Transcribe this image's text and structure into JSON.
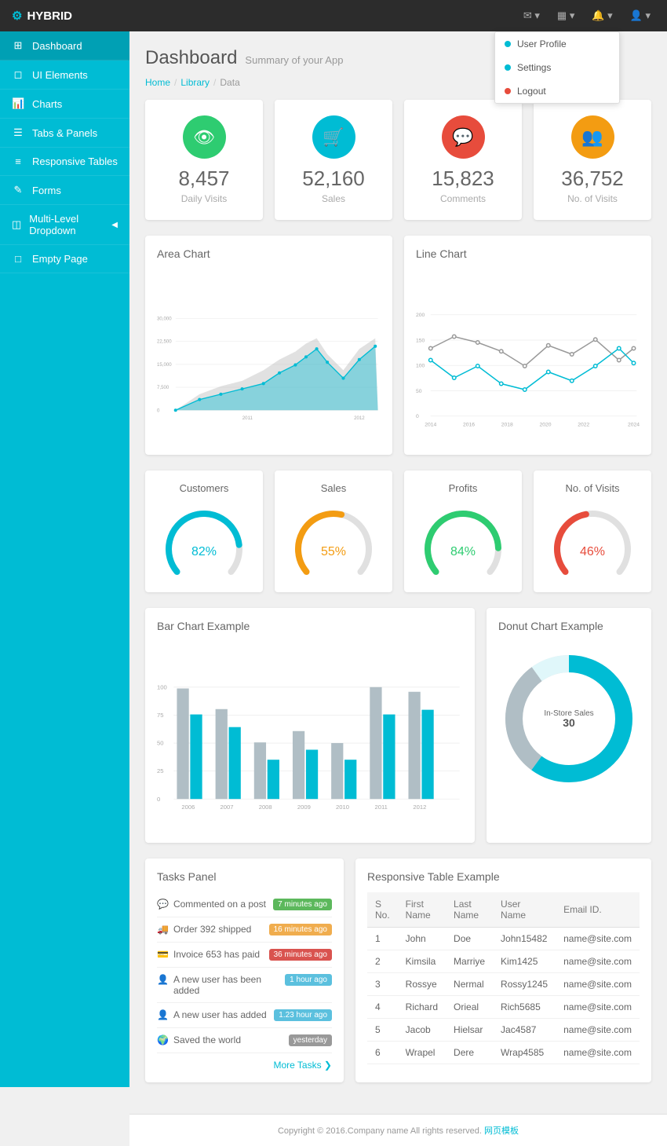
{
  "brand": {
    "name": "HYBRID",
    "icon": "⚙"
  },
  "topnav": {
    "email_icon": "✉",
    "grid_icon": "▦",
    "bell_icon": "🔔",
    "user_icon": "👤"
  },
  "dropdown": {
    "items": [
      {
        "label": "User Profile",
        "dot": "blue"
      },
      {
        "label": "Settings",
        "dot": "teal"
      },
      {
        "label": "Logout",
        "dot": "red"
      }
    ]
  },
  "sidebar": {
    "items": [
      {
        "id": "dashboard",
        "label": "Dashboard",
        "icon": "⊞",
        "active": true
      },
      {
        "id": "ui-elements",
        "label": "UI Elements",
        "icon": "◻"
      },
      {
        "id": "charts",
        "label": "Charts",
        "icon": "📊"
      },
      {
        "id": "tabs-panels",
        "label": "Tabs & Panels",
        "icon": "☰"
      },
      {
        "id": "responsive-tables",
        "label": "Responsive Tables",
        "icon": "≡"
      },
      {
        "id": "forms",
        "label": "Forms",
        "icon": "✎"
      },
      {
        "id": "multi-level",
        "label": "Multi-Level Dropdown",
        "icon": "◫",
        "has_arrow": true
      },
      {
        "id": "empty-page",
        "label": "Empty Page",
        "icon": "□"
      }
    ]
  },
  "page": {
    "title": "Dashboard",
    "subtitle": "Summary of your App"
  },
  "breadcrumb": [
    "Home",
    "Library",
    "Data"
  ],
  "stats": [
    {
      "id": "daily-visits",
      "value": "8,457",
      "label": "Daily Visits",
      "icon": "👁",
      "color": "#2ecc71"
    },
    {
      "id": "sales",
      "value": "52,160",
      "label": "Sales",
      "icon": "🛒",
      "color": "#00bcd4"
    },
    {
      "id": "comments",
      "value": "15,823",
      "label": "Comments",
      "icon": "💬",
      "color": "#e74c3c"
    },
    {
      "id": "no-of-visits",
      "value": "36,752",
      "label": "No. of Visits",
      "icon": "👥",
      "color": "#f39c12"
    }
  ],
  "area_chart": {
    "title": "Area Chart",
    "labels": [
      "2011",
      "2012"
    ],
    "y_labels": [
      "0",
      "7,500",
      "15,000",
      "22,500",
      "30,000"
    ]
  },
  "line_chart": {
    "title": "Line Chart",
    "x_labels": [
      "2014",
      "2016",
      "2018",
      "2020",
      "2022",
      "2024"
    ],
    "y_labels": [
      "0",
      "50",
      "100",
      "150",
      "200"
    ]
  },
  "gauges": [
    {
      "id": "customers",
      "label": "Customers",
      "value": 82,
      "display": "82%",
      "color": "#00bcd4"
    },
    {
      "id": "sales",
      "label": "Sales",
      "value": 55,
      "display": "55%",
      "color": "#f39c12"
    },
    {
      "id": "profits",
      "label": "Profits",
      "value": 84,
      "display": "84%",
      "color": "#2ecc71"
    },
    {
      "id": "no-of-visits",
      "label": "No. of Visits",
      "value": 46,
      "display": "46%",
      "color": "#e74c3c"
    }
  ],
  "bar_chart": {
    "title": "Bar Chart Example",
    "years": [
      "2006",
      "2007",
      "2008",
      "2009",
      "2010",
      "2011",
      "2012"
    ],
    "y_labels": [
      "0",
      "25",
      "50",
      "75",
      "100"
    ],
    "bars": [
      [
        95,
        70
      ],
      [
        80,
        62
      ],
      [
        48,
        35
      ],
      [
        60,
        42
      ],
      [
        47,
        32
      ],
      [
        98,
        75
      ],
      [
        90,
        68
      ]
    ]
  },
  "donut_chart": {
    "title": "Donut Chart Example",
    "center_label": "In-Store Sales",
    "center_value": "30"
  },
  "tasks": {
    "title": "Tasks Panel",
    "items": [
      {
        "text": "Commented on a post",
        "badge": "7 minutes ago",
        "badge_type": "green",
        "icon": "💬"
      },
      {
        "text": "Order 392 shipped",
        "badge": "16 minutes ago",
        "badge_type": "orange",
        "icon": "🚚"
      },
      {
        "text": "Invoice 653 has paid",
        "badge": "36 minutes ago",
        "badge_type": "red",
        "icon": "💳"
      },
      {
        "text": "A new user has been added",
        "badge": "1 hour ago",
        "badge_type": "blue",
        "icon": "👤"
      },
      {
        "text": "A new user has added",
        "badge": "1.23 hour ago",
        "badge_type": "blue",
        "icon": "👤"
      },
      {
        "text": "Saved the world",
        "badge": "yesterday",
        "badge_type": "gray",
        "icon": "🌍"
      }
    ],
    "more_label": "More Tasks ❯"
  },
  "table": {
    "title": "Responsive Table Example",
    "headers": [
      "S No.",
      "First Name",
      "Last Name",
      "User Name",
      "Email ID."
    ],
    "rows": [
      [
        "1",
        "John",
        "Doe",
        "John15482",
        "name@site.com"
      ],
      [
        "2",
        "Kimsila",
        "Marriye",
        "Kim1425",
        "name@site.com"
      ],
      [
        "3",
        "Rossye",
        "Nermal",
        "Rossy1245",
        "name@site.com"
      ],
      [
        "4",
        "Richard",
        "Orieal",
        "Rich5685",
        "name@site.com"
      ],
      [
        "5",
        "Jacob",
        "Hielsar",
        "Jac4587",
        "name@site.com"
      ],
      [
        "6",
        "Wrapel",
        "Dere",
        "Wrap4585",
        "name@site.com"
      ]
    ]
  },
  "footer": {
    "text": "Copyright © 2016.Company name All rights reserved.",
    "link_text": "网页模板"
  }
}
